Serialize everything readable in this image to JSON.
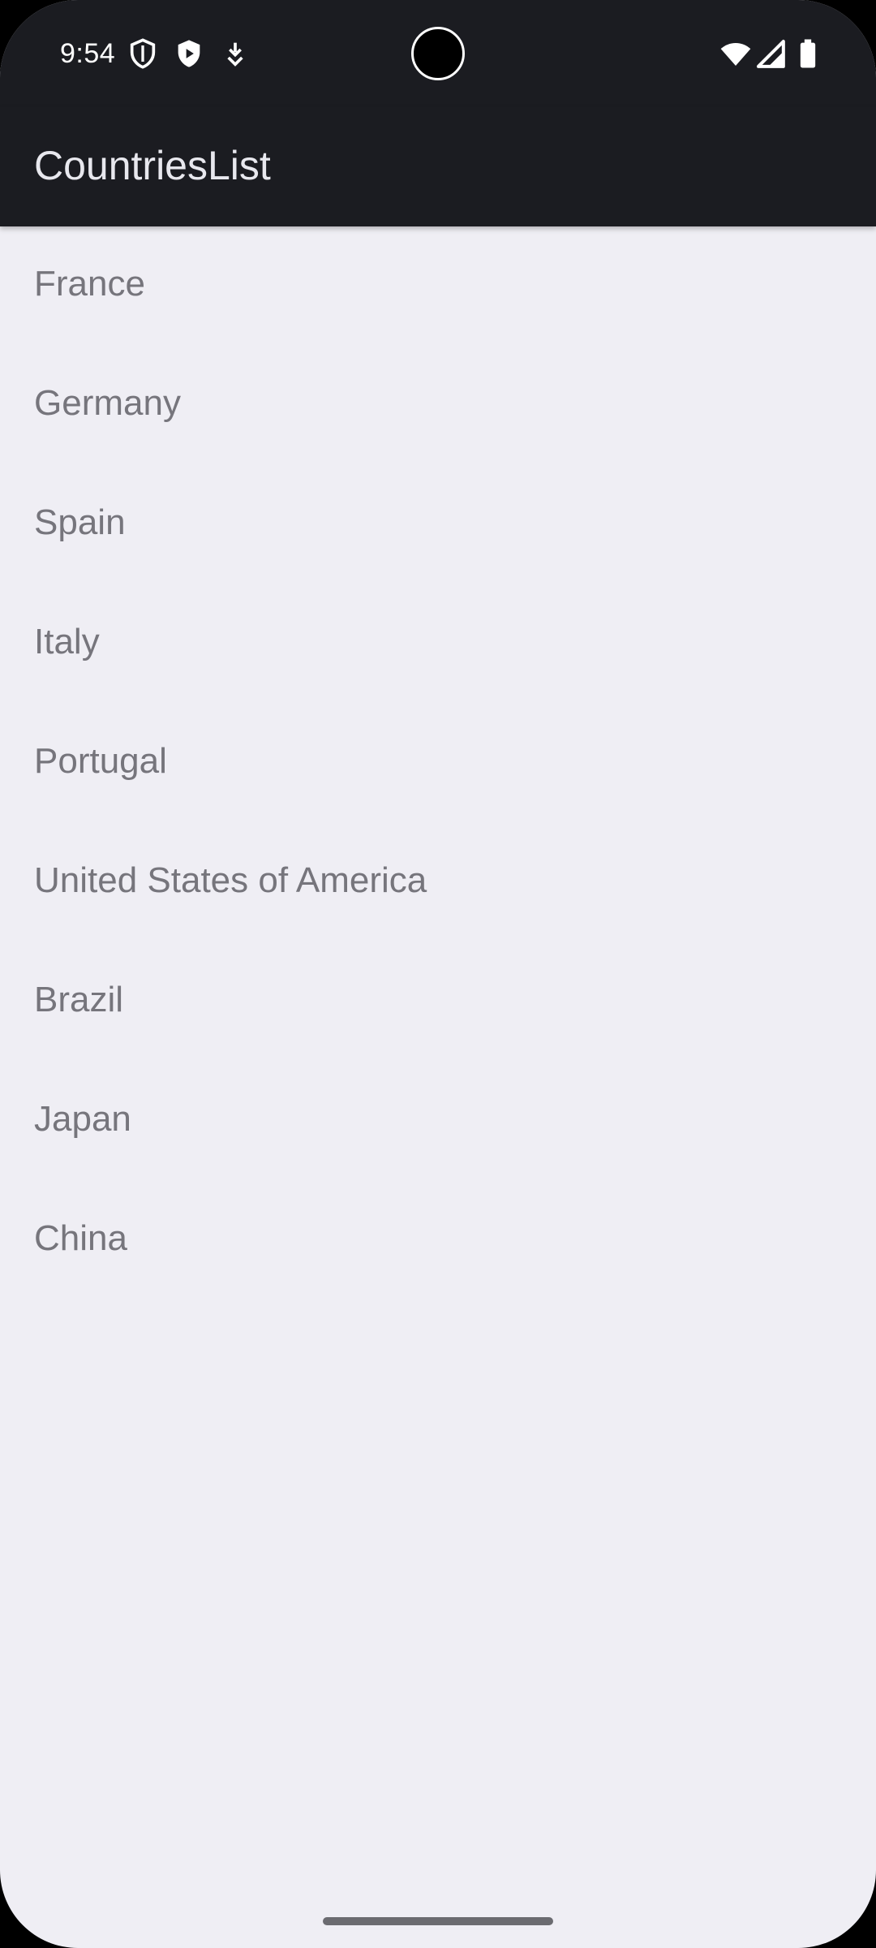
{
  "status_bar": {
    "time": "9:54",
    "left_icons": [
      "shield-outline-icon",
      "play-shield-icon",
      "download-icon"
    ],
    "right_icons": [
      "wifi-icon",
      "cellular-signal-icon",
      "battery-icon"
    ]
  },
  "app_bar": {
    "title": "CountriesList"
  },
  "countries": [
    {
      "label": "France"
    },
    {
      "label": "Germany"
    },
    {
      "label": "Spain"
    },
    {
      "label": "Italy"
    },
    {
      "label": "Portugal"
    },
    {
      "label": "United States of America"
    },
    {
      "label": "Brazil"
    },
    {
      "label": "Japan"
    },
    {
      "label": "China"
    }
  ],
  "colors": {
    "app_bar_bg": "#1b1c21",
    "content_bg": "#efeef4",
    "list_text": "#76757c",
    "title_text": "#e8e8ee"
  }
}
